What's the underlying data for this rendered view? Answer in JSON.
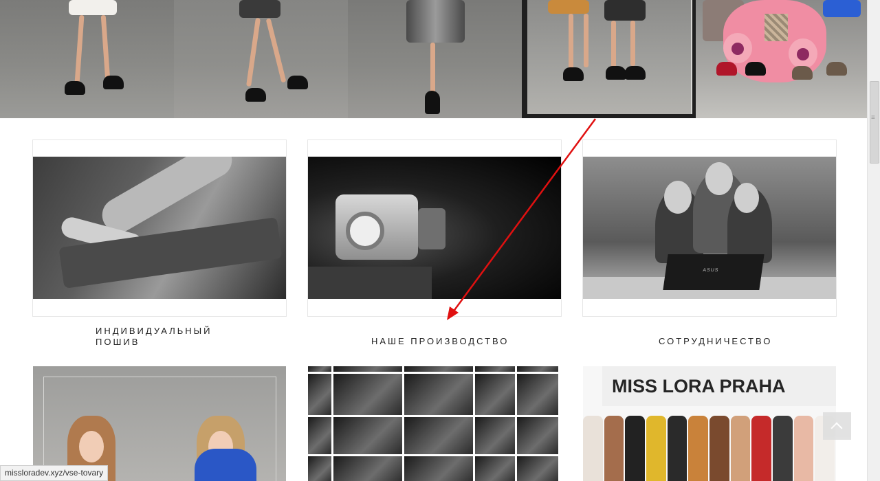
{
  "cards": [
    {
      "title_line1": "ИНДИВИДУАЛЬНЫЙ",
      "title_line2": "ПОШИВ"
    },
    {
      "title": "НАШЕ ПРОИЗВОДСТВО"
    },
    {
      "title": "СОТРУДНИЧЕСТВО"
    }
  ],
  "bottom": {
    "booth_sign": "MISS LORA PRAHA"
  },
  "team_image": {
    "laptop_brand": "ASUS"
  },
  "status_bar": {
    "url": "missloradev.xyz/vse-tovary"
  },
  "icons": {
    "back_to_top": "chevron-up-icon",
    "annotation": "red-arrow-annotation"
  },
  "colors": {
    "annotation": "#e01010",
    "status_bg": "#f2f2f2"
  }
}
